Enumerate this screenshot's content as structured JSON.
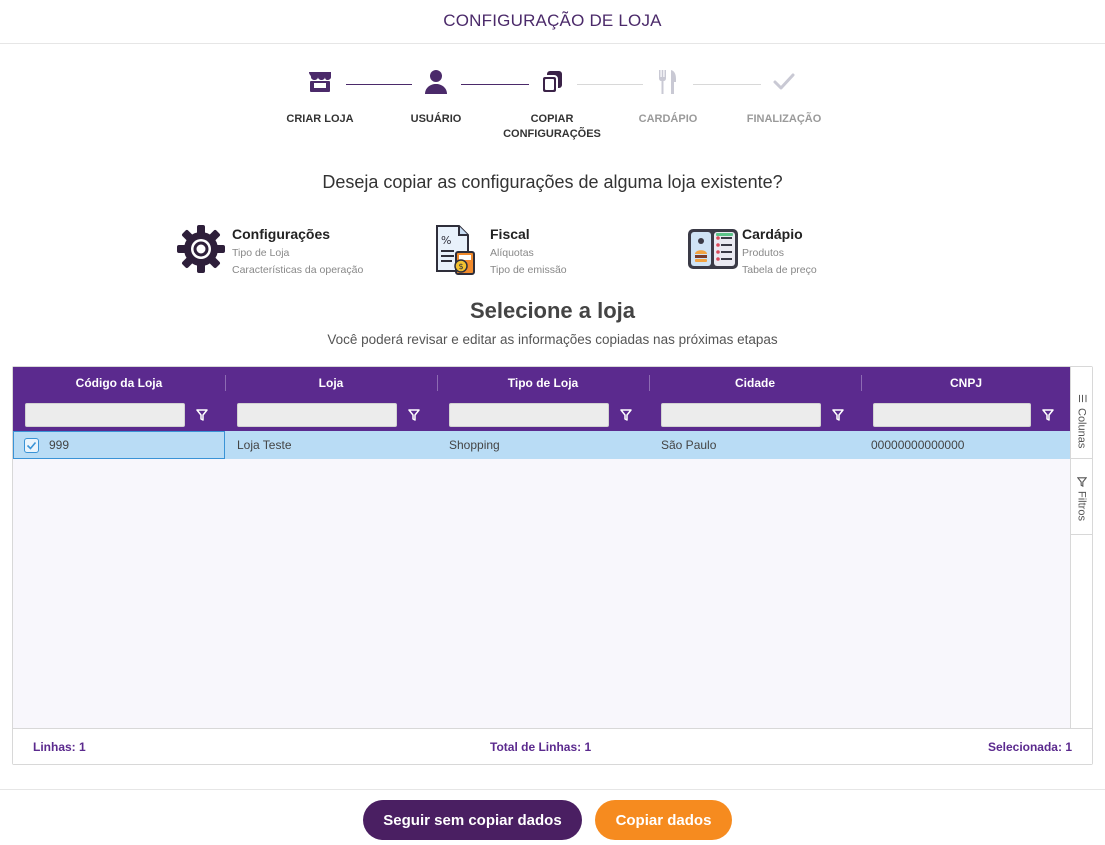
{
  "header": {
    "title": "CONFIGURAÇÃO DE LOJA"
  },
  "stepper": {
    "steps": [
      {
        "label": "CRIAR LOJA",
        "icon": "store-icon",
        "state": "done"
      },
      {
        "label": "USUÁRIO",
        "icon": "user-icon",
        "state": "done"
      },
      {
        "label": "COPIAR CONFIGURAÇÕES",
        "icon": "copy-icon",
        "state": "current"
      },
      {
        "label": "CARDÁPIO",
        "icon": "utensils-icon",
        "state": "pending"
      },
      {
        "label": "FINALIZAÇÃO",
        "icon": "check-icon",
        "state": "pending"
      }
    ]
  },
  "question": "Deseja copiar as configurações de alguma loja existente?",
  "features": [
    {
      "title": "Configurações",
      "line1": "Tipo de Loja",
      "line2": "Características da operação",
      "icon": "gear-icon"
    },
    {
      "title": "Fiscal",
      "line1": "Alíquotas",
      "line2": "Tipo de emissão",
      "icon": "tax-document-icon"
    },
    {
      "title": "Cardápio",
      "line1": "Produtos",
      "line2": "Tabela de preço",
      "icon": "menu-board-icon"
    }
  ],
  "selection": {
    "title": "Selecione a loja",
    "subtitle": "Você poderá revisar e editar as informações copiadas nas próximas etapas"
  },
  "grid": {
    "columns": [
      "Código da Loja",
      "Loja",
      "Tipo de Loja",
      "Cidade",
      "CNPJ"
    ],
    "rows": [
      {
        "codigo": "999",
        "loja": "Loja Teste",
        "tipo": "Shopping",
        "cidade": "São Paulo",
        "cnpj": "00000000000000",
        "selected": true
      }
    ],
    "side_panel": {
      "columns_label": "Colunas",
      "filters_label": "Filtros"
    },
    "footer": {
      "rows": "Linhas: 1",
      "total": "Total de Linhas: 1",
      "selected": "Selecionada: 1"
    }
  },
  "actions": {
    "skip_label": "Seguir sem copiar dados",
    "copy_label": "Copiar dados"
  },
  "colors": {
    "primary": "#5b2a8e",
    "dark": "#4a1f62",
    "accent": "#f68b1f",
    "selected_row": "#b9dcf5"
  }
}
